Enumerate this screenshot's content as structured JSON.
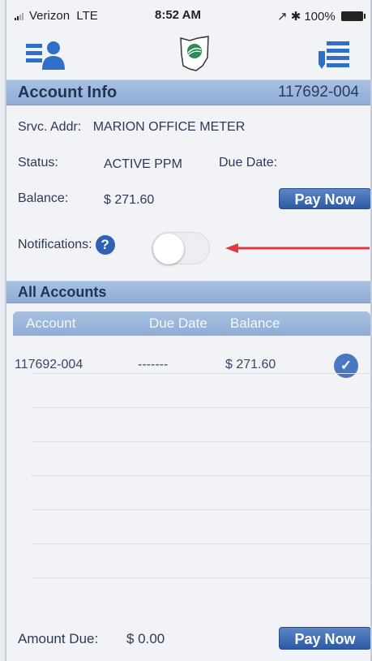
{
  "status_bar": {
    "carrier": "Verizon",
    "network": "LTE",
    "time": "8:52 AM",
    "icons": "↗ ✱",
    "battery": "100%"
  },
  "nav": {
    "left_icon": "account-card-icon",
    "center_icon": "ohio-logo-icon",
    "right_icon": "bill-list-icon"
  },
  "account_info": {
    "header": "Account Info",
    "account_number": "117692-004",
    "srvc_addr_label": "Srvc. Addr:",
    "srvc_addr_value": "MARION OFFICE METER",
    "status_label": "Status:",
    "status_value": "ACTIVE PPM",
    "due_date_label": "Due Date:",
    "balance_label": "Balance:",
    "balance_value": "$ 271.60",
    "pay_now_label": "Pay Now",
    "notifications_label": "Notifications:",
    "help_glyph": "?",
    "notifications_on": false
  },
  "all_accounts": {
    "header": "All Accounts",
    "columns": [
      "Account",
      "Due Date",
      "Balance"
    ],
    "rows": [
      {
        "account": "117692-004",
        "due_date": "-------",
        "balance": "$ 271.60",
        "selected": true
      }
    ]
  },
  "footer": {
    "amount_due_label": "Amount Due:",
    "amount_due_value": "$ 0.00",
    "pay_now_label": "Pay Now"
  },
  "colors": {
    "header_blue": "#8facd6",
    "button_blue": "#2c5aa3",
    "arrow_red": "#e03a3e"
  }
}
